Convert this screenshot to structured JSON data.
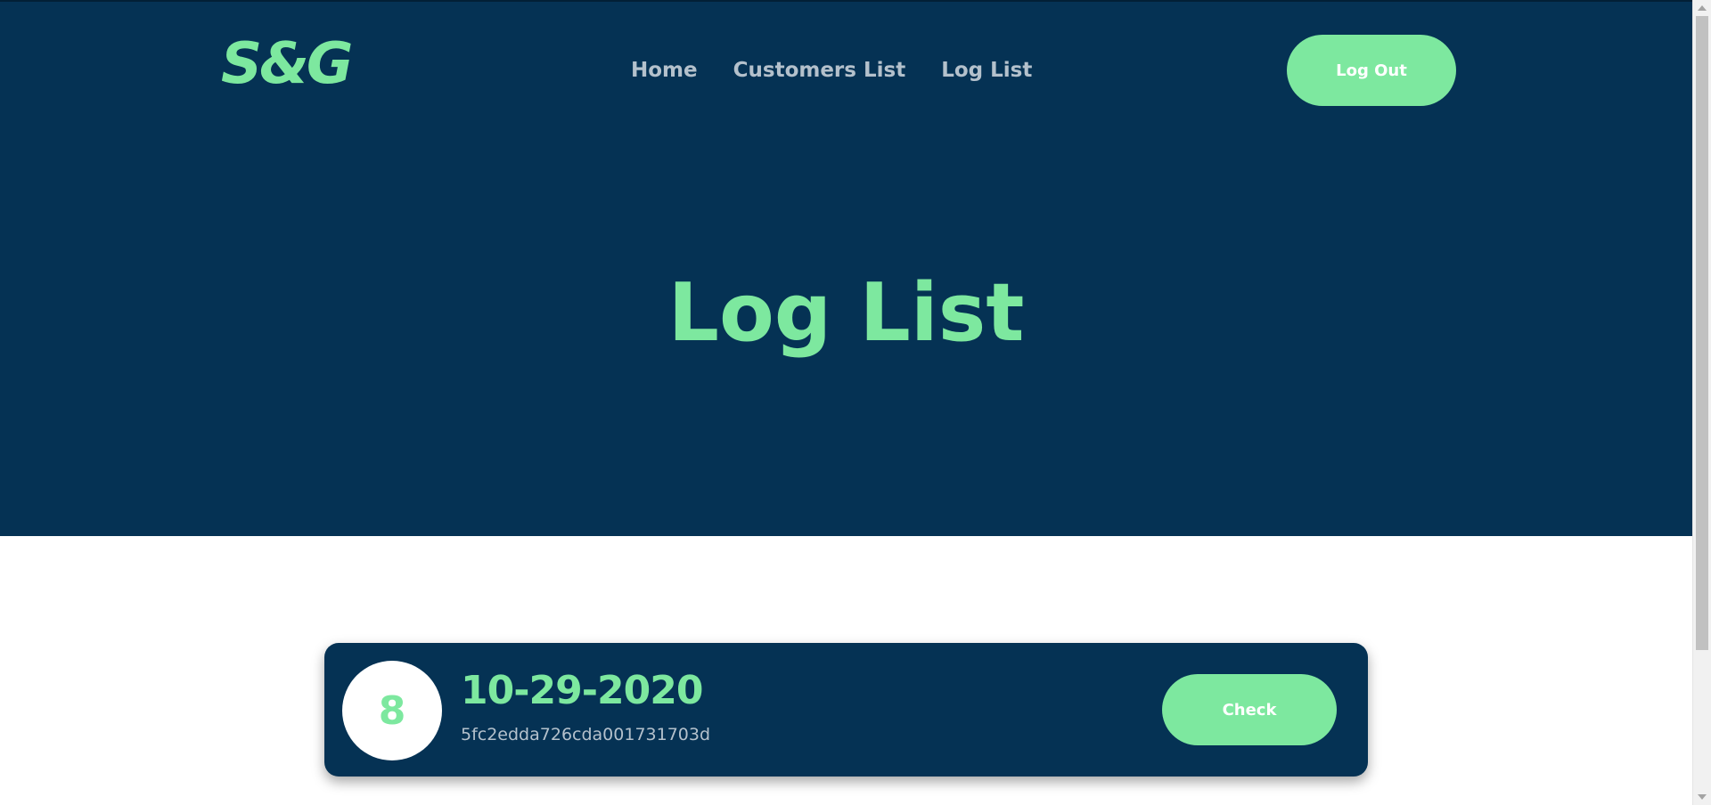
{
  "header": {
    "logo": "S&G",
    "nav": {
      "home": "Home",
      "customers": "Customers List",
      "logs": "Log List"
    },
    "logout_label": "Log Out"
  },
  "hero": {
    "title": "Log List"
  },
  "log_entries": [
    {
      "count": "8",
      "date": "10-29-2020",
      "id": "5fc2edda726cda001731703d",
      "action_label": "Check"
    }
  ],
  "colors": {
    "navy": "#053254",
    "accent_green": "#7de89f",
    "nav_text": "#b4c1cc",
    "white": "#ffffff"
  }
}
